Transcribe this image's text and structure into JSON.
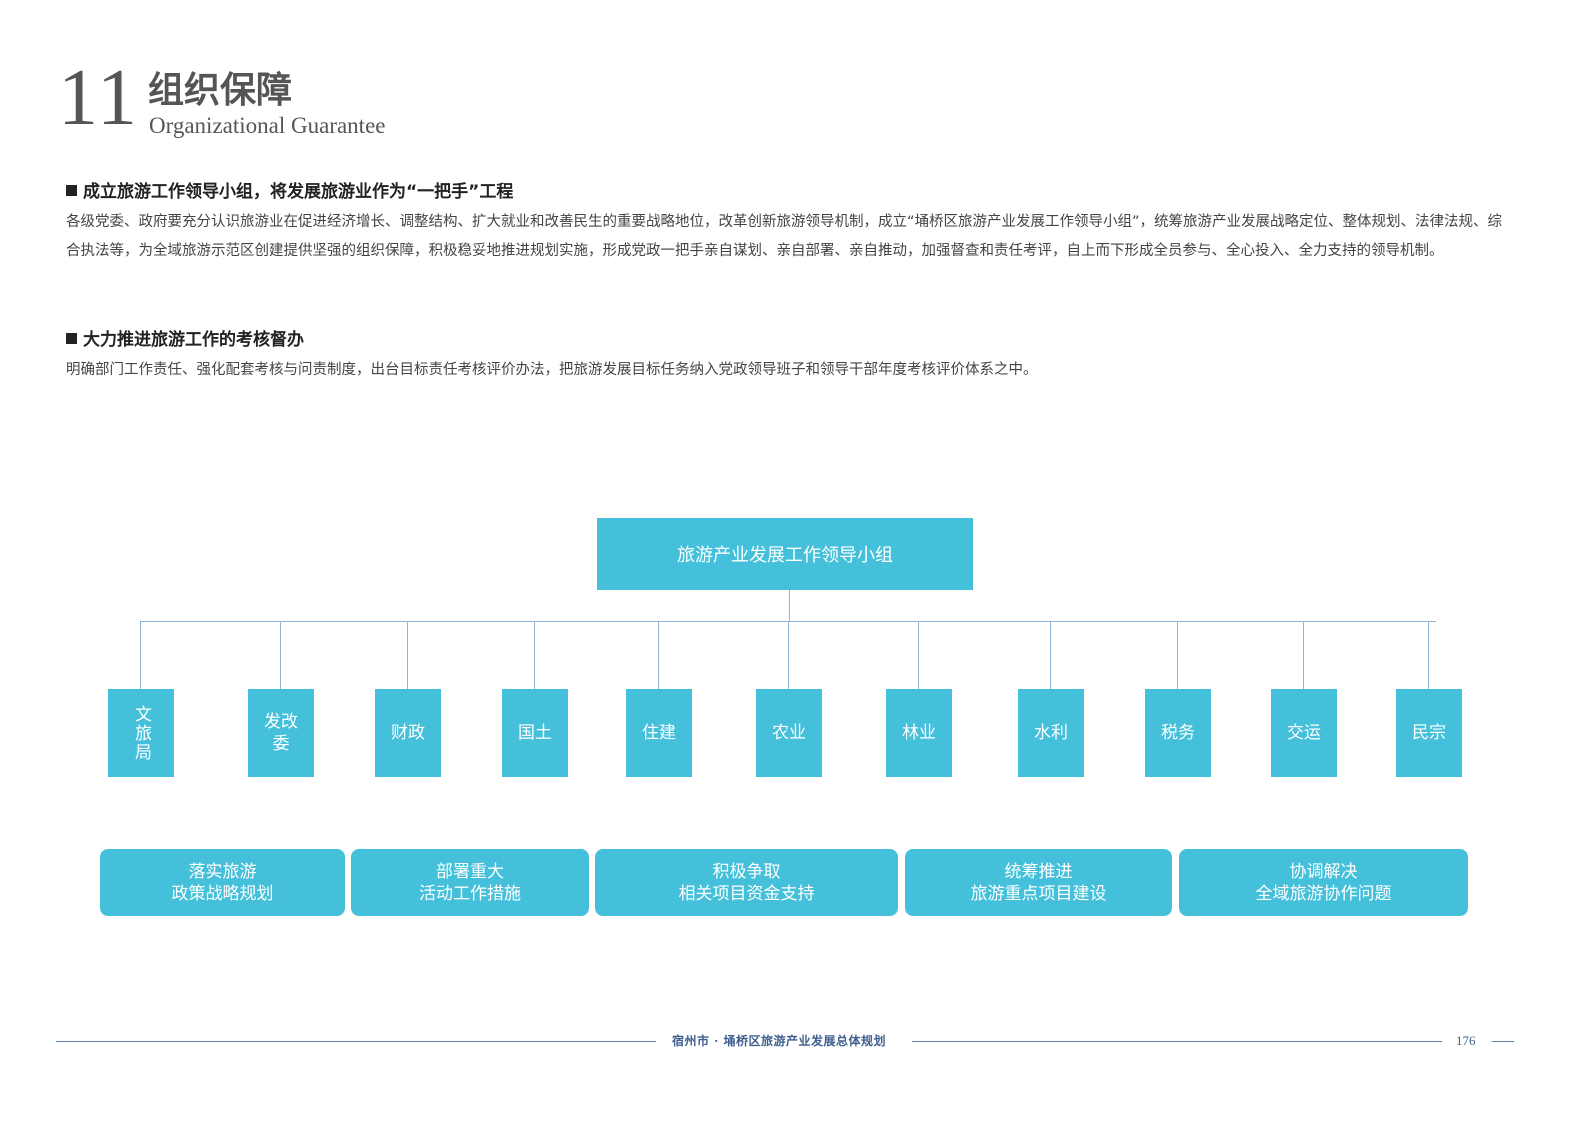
{
  "header": {
    "chapter_number": "11",
    "title_cn": "组织保障",
    "title_en": "Organizational Guarantee"
  },
  "sections": [
    {
      "heading": "成立旅游工作领导小组，将发展旅游业作为“一把手”工程",
      "body": " 各级党委、政府要充分认识旅游业在促进经济增长、调整结构、扩大就业和改善民生的重要战略地位，改革创新旅游领导机制，成立“埇桥区旅游产业发展工作领导小组”，统筹旅游产业发展战略定位、整体规划、法律法规、综合执法等，为全域旅游示范区创建提供坚强的组织保障，积极稳妥地推进规划实施，形成党政一把手亲自谋划、亲自部署、亲自推动，加强督查和责任考评，自上而下形成全员参与、全心投入、全力支持的领导机制。"
    },
    {
      "heading": "大力推进旅游工作的考核督办",
      "body": "明确部门工作责任、强化配套考核与问责制度，出台目标责任考核评价办法，把旅游发展目标任务纳入党政领导班子和领导干部年度考核评价体系之中。"
    }
  ],
  "org_chart": {
    "top": "旅游产业发展工作领导小组",
    "departments": [
      "文旅局",
      "发改委",
      "财政",
      "国土",
      "住建",
      "农业",
      "林业",
      "水利",
      "税务",
      "交运",
      "民宗"
    ],
    "functions": [
      {
        "line1": "落实旅游",
        "line2": "政策战略规划"
      },
      {
        "line1": "部署重大",
        "line2": "活动工作措施"
      },
      {
        "line1": "积极争取",
        "line2": "相关项目资金支持"
      },
      {
        "line1": "统筹推进",
        "line2": "旅游重点项目建设"
      },
      {
        "line1": "协调解决",
        "line2": "全域旅游协作问题"
      }
    ]
  },
  "footer": {
    "text": "宿州市 · 埇桥区旅游产业发展总体规划",
    "page": "176"
  },
  "colors": {
    "box": "#45c0da",
    "connector": "#8fb4d6",
    "footer": "#3f5f8f"
  }
}
